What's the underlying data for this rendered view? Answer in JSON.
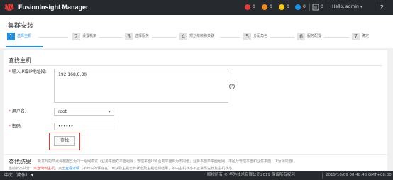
{
  "topbar": {
    "app_title": "FusionInsight Manager",
    "alarms": [
      {
        "name": "critical",
        "count": "0",
        "color": "#e03c3c"
      },
      {
        "name": "major",
        "count": "0",
        "color": "#f08a24"
      },
      {
        "name": "minor",
        "count": "0",
        "color": "#f5c518"
      },
      {
        "name": "warning",
        "count": "0",
        "color": "#2090e0"
      }
    ],
    "user_menu": "Hello, admin ▾",
    "help": "?"
  },
  "page": {
    "title": "集群安装",
    "steps": [
      {
        "num": "1",
        "label": "选择主机"
      },
      {
        "num": "2",
        "label": "设置机架"
      },
      {
        "num": "3",
        "label": "选择服务"
      },
      {
        "num": "4",
        "label": "规划依赖和关联"
      },
      {
        "num": "5",
        "label": "分配角色"
      },
      {
        "num": "6",
        "label": "服务配置"
      },
      {
        "num": "7",
        "label": "确定"
      }
    ]
  },
  "form": {
    "section_title": "查找主机",
    "ip_label": "输入IP或IP地址段:",
    "ip_value": "192.168.8.30",
    "help_icon": "?",
    "user_label": "用户名:",
    "user_value": "root",
    "password_label": "密码:",
    "password_value": "••••••",
    "find_button": "查找"
  },
  "results": {
    "title": "查找结果",
    "description": "新发现的节点会根据已为同一组网模式（业务平面双平面组网，管理平面IP和业务平面IP为不同值；业务平面单平面组网，不区分管理平面和业务平面，IP为相同值）。",
    "line2_prefix": "当前状态共分：",
    "line2_red": "未查询到主机",
    "line2_mid": "，点击",
    "line2_blue": "查看详情",
    "line2_suffix": "（不知识的保存在）可获取主机已有状态及主机检测结果，如由主机状态不正常需先修复主机状态。"
  },
  "statusbar": {
    "language": "中文（简体） ▾",
    "copyright": "版权所有 © 华为技术有限公司2019 保留所有权利",
    "datetime": "2019/10/09 08:48:48 GMT+08:00"
  }
}
